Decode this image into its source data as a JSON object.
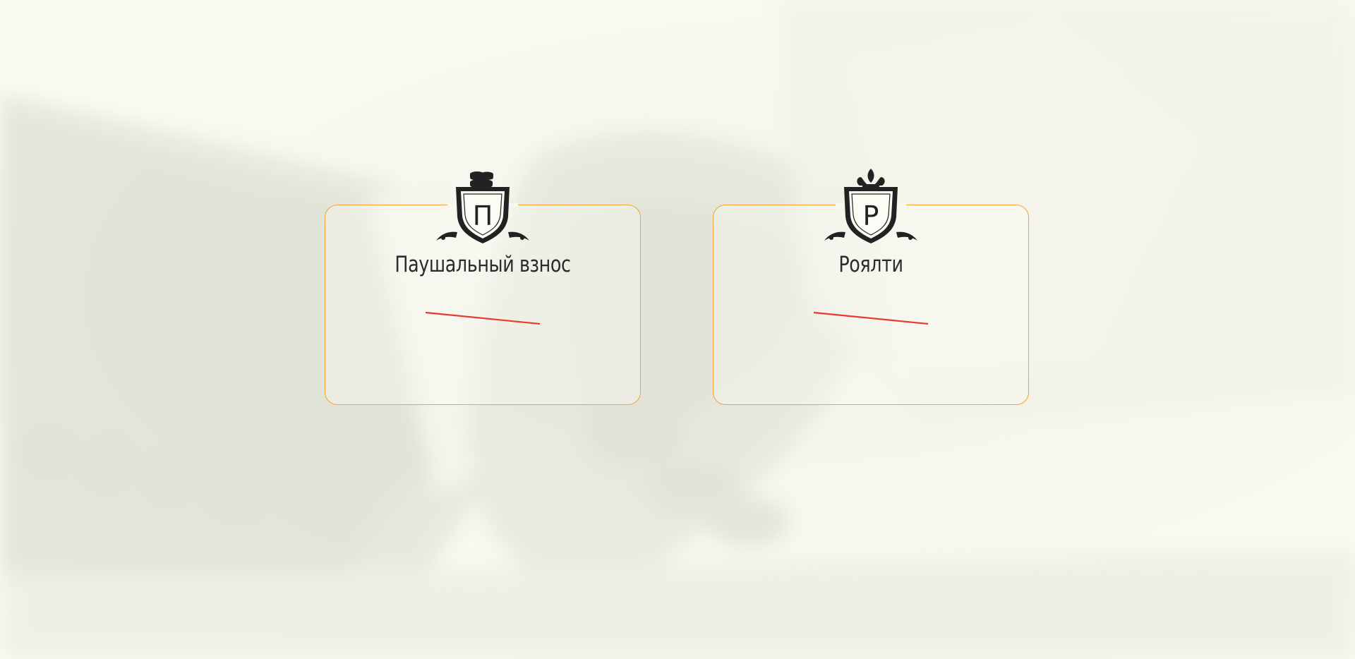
{
  "cards": [
    {
      "title": "Паушальный взнос",
      "emblem_letter": "П",
      "crest_icon": "coins-stack-icon",
      "accent_color": "#f0a43a",
      "divider_color": "#e53c2e"
    },
    {
      "title": "Роялти",
      "emblem_letter": "Р",
      "crest_icon": "fleur-de-lis-icon",
      "accent_color": "#f0a43a",
      "divider_color": "#e53c2e"
    }
  ],
  "background": {
    "description_icon": "handshake-photo-icon"
  }
}
